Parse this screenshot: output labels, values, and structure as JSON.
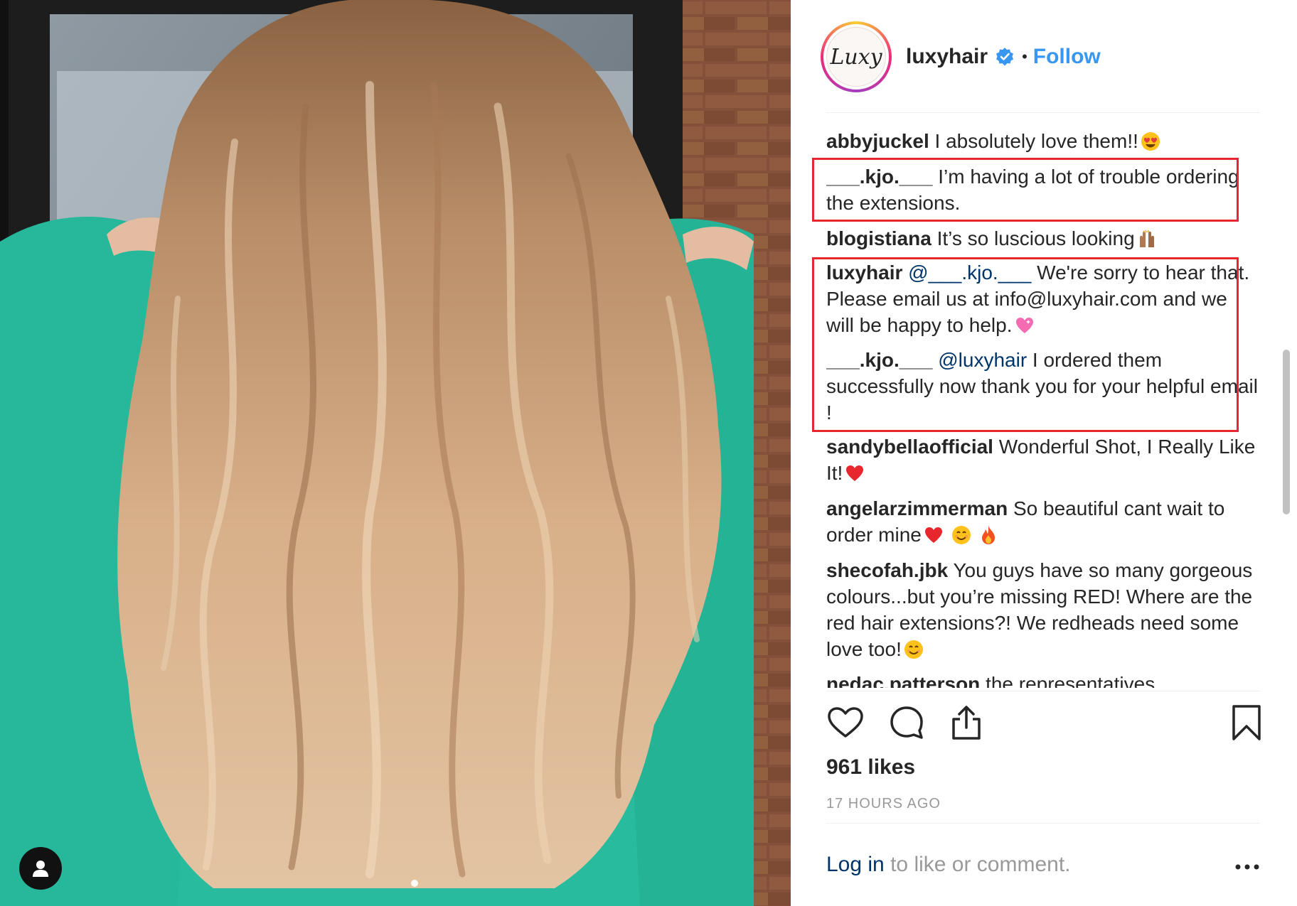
{
  "header": {
    "username": "luxyhair",
    "avatar_text": "Luxy",
    "separator": "•",
    "follow_label": "Follow"
  },
  "comments": [
    {
      "user": "abbyjuckel",
      "text": "I absolutely love them!!",
      "emoji": "heart-eyes-emoji"
    },
    {
      "user": "___.kjo.___",
      "text": "I’m having a lot of trouble ordering the extensions."
    },
    {
      "user": "blogistiana",
      "text": "It’s so luscious looking",
      "emoji": "raised-hands-emoji"
    },
    {
      "user": "luxyhair",
      "mention": "@___.kjo.___",
      "text": "We're sorry to hear that. Please email us at info@luxyhair.com and we will be happy to help.",
      "emoji": "sparkling-heart-emoji"
    },
    {
      "user": "___.kjo.___",
      "mention": "@luxyhair",
      "text": "I ordered them successfully now thank you for your helpful email !"
    },
    {
      "user": "sandybellaofficial",
      "text": "Wonderful Shot, I Really Like It!",
      "emoji": "red-heart-emoji"
    },
    {
      "user": "angelarzimmerman",
      "text": "So beautiful cant wait to order mine",
      "emoji": "red-heart-smile-fire-emoji"
    },
    {
      "user": "shecofah.jbk",
      "text": "You guys have so many gorgeous colours...but you’re missing RED! Where are the red hair extensions?! We redheads need some love too!",
      "emoji": "smile-emoji"
    },
    {
      "user": "nedac.patterson",
      "text": "the representatives"
    }
  ],
  "likes": "961 likes",
  "timestamp": "17 HOURS AGO",
  "login": {
    "link": "Log in",
    "rest": " to like or comment."
  },
  "colors": {
    "accent": "#3897f0",
    "highlight": "#e8262d",
    "mention": "#003569"
  }
}
